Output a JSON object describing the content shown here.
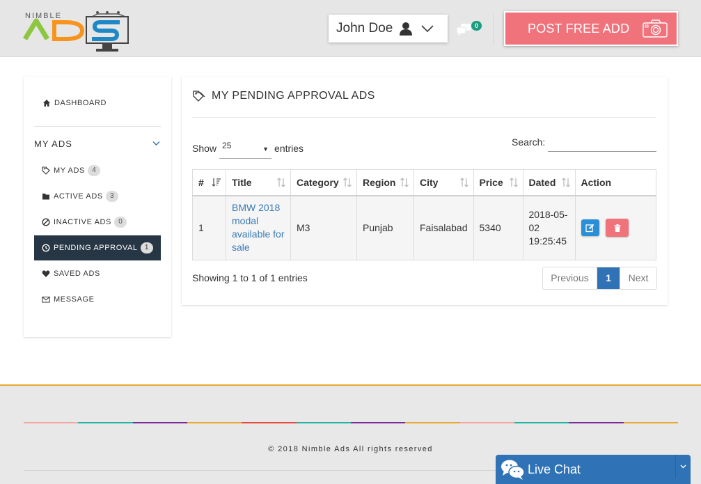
{
  "brand": {
    "logo_top_text": "NIMBLE",
    "logo_main_text": "ADS",
    "logo_colors": [
      "#8dc63f",
      "#f7941d",
      "#1e88c7"
    ]
  },
  "header": {
    "user_name": "John Doe",
    "user_icon": "user-icon",
    "messages_icon": "chat-bubbles-icon",
    "messages_count": "0",
    "post_button_label": "POST FREE ADD",
    "post_button_icon": "camera-icon",
    "post_button_color": "#f0737c"
  },
  "sidebar": {
    "dashboard": {
      "label": "DASHBOARD",
      "icon": "home-icon"
    },
    "my_ads_header": "MY ADS",
    "items": [
      {
        "label": "MY ADS",
        "badge": "4",
        "icon": "tags-icon"
      },
      {
        "label": "ACTIVE ADS",
        "badge": "3",
        "icon": "folder-icon"
      },
      {
        "label": "INACTIVE ADS",
        "badge": "0",
        "icon": "ban-icon"
      },
      {
        "label": "PENDING APPROVAL",
        "badge": "1",
        "icon": "clock-icon",
        "active": true
      },
      {
        "label": "SAVED ADS",
        "icon": "heart-icon"
      },
      {
        "label": "MESSAGE",
        "icon": "envelope-icon"
      }
    ]
  },
  "main": {
    "title": "MY PENDING APPROVAL ADS",
    "show_label": "Show",
    "entries_label": "entries",
    "page_length": "25",
    "search_label": "Search:",
    "search_value": "",
    "columns": [
      "#",
      "Title",
      "Category",
      "Region",
      "City",
      "Price",
      "Dated",
      "Action"
    ],
    "rows": [
      {
        "num": "1",
        "title_lines": [
          "BMW 2018",
          "modal",
          "available for",
          "sale"
        ],
        "category": "M3",
        "region": "Punjab",
        "city": "Faisalabad",
        "price": "5340",
        "dated_lines": [
          "2018-05-",
          "02",
          "19:25:45"
        ]
      }
    ],
    "info": "Showing 1 to 1 of 1 entries",
    "pagination": {
      "previous": "Previous",
      "current": "1",
      "next": "Next"
    }
  },
  "footer": {
    "copyright": "© 2018 Nimble Ads All rights reserved",
    "stripe_colors": [
      "#f4a6a0",
      "#1fb5a3",
      "#7b2b97",
      "#e6a92e",
      "#e8473c",
      "#1fb5a3",
      "#7b2b97",
      "#e6a92e",
      "#f4a6a0",
      "#1fb5a3",
      "#7b2b97",
      "#e6a92e"
    ]
  },
  "live_chat": {
    "label": "Live Chat",
    "icon": "chat-bubbles-icon"
  }
}
